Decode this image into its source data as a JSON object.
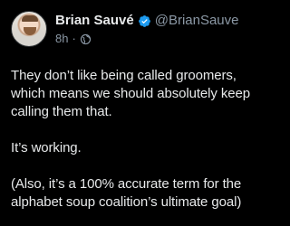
{
  "author": {
    "display_name": "Brian Sauvé",
    "handle": "@BrianSauve",
    "verified_icon": "verified-badge-icon",
    "timestamp": "8h",
    "visibility_icon": "globe-icon"
  },
  "tweet": {
    "paragraphs": [
      "They don’t like being called groomers, which means we should absolutely keep calling them that.",
      "It’s working.",
      "(Also, it’s a 100% accurate term for the alphabet soup coalition’s ultimate goal)"
    ]
  },
  "colors": {
    "background": "#000000",
    "text": "#e7e9ea",
    "muted": "#8b98a5",
    "verified": "#1d9bf0"
  }
}
